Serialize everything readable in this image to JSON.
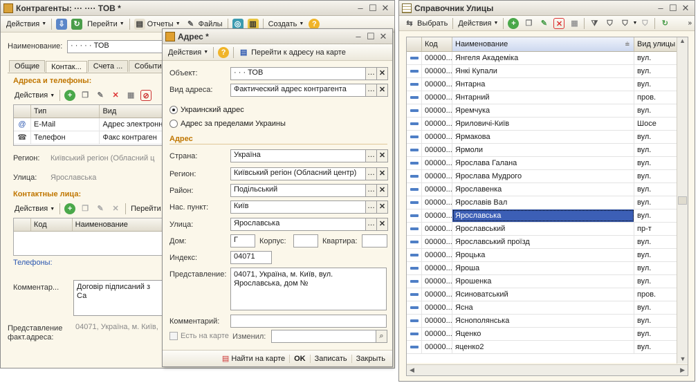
{
  "win1": {
    "title": "Контрагенты: ··· ···· ТОВ *",
    "toolbar": {
      "actions": "Действия",
      "goto": "Перейти",
      "reports": "Отчеты",
      "files": "Файлы",
      "create": "Создать"
    },
    "name_label": "Наименование:",
    "name_value": "· · ·  ·  ·  ТОВ",
    "tabs": [
      "Общие",
      "Контак...",
      "Счета ...",
      "События"
    ],
    "section_addresses": "Адреса и телефоны:",
    "grid_actions": "Действия",
    "contacts_header": [
      "Тип",
      "Вид"
    ],
    "contacts_rows": [
      {
        "icon": "@",
        "type": "E-Mail",
        "kind": "Адрес электронн"
      },
      {
        "icon": "☎",
        "type": "Телефон",
        "kind": "Факс контраген"
      }
    ],
    "region_label": "Регион:",
    "region_value": "Київський регіон  (Обласний ц",
    "street_label": "Улица:",
    "street_value": "Ярославська",
    "section_persons": "Контактные лица:",
    "persons_actions": "Действия",
    "persons_goto": "Перейти",
    "persons_header": [
      "Код",
      "Наименование"
    ],
    "phones_link": "Телефоны:",
    "comment_label": "Комментар...",
    "comment_value": "Договір підписаний з Са",
    "fact_label": "Представление\nфакт.адреса:",
    "fact_value": "04071, Україна, м. Київ,"
  },
  "win2": {
    "title": "Адрес *",
    "toolbar": {
      "actions": "Действия",
      "goto_map": "Перейти к адресу на карте"
    },
    "object_label": "Объект:",
    "object_value": "·  ·  ·  ТОВ",
    "addrtype_label": "Вид адреса:",
    "addrtype_value": "Фактический адрес контрагента",
    "radio_ukr": "Украинский адрес",
    "radio_foreign": "Адрес за пределами Украины",
    "section_address": "Адрес",
    "country_label": "Страна:",
    "country_value": "Україна",
    "region_label": "Регион:",
    "region_value": "Київський регіон  (Обласний центр)",
    "district_label": "Район:",
    "district_value": "Подільський",
    "city_label": "Нас. пункт:",
    "city_value": "Київ",
    "street_label": "Улица:",
    "street_value": "Ярославська",
    "house_label": "Дом:",
    "house_value": "Г",
    "korpus_label": "Корпус:",
    "korpus_value": "",
    "flat_label": "Квартира:",
    "flat_value": "",
    "index_label": "Индекс:",
    "index_value": "04071",
    "repr_label": "Представление:",
    "repr_value": "04071, Україна, м. Київ, вул.\nЯрославська, дом №",
    "comment_label": "Комментарий:",
    "comment_value": "",
    "onmap_label": "Есть на карте",
    "changed_label": "Изменил:",
    "changed_value": "",
    "buttons": {
      "map": "Найти на карте",
      "ok": "OK",
      "save": "Записать",
      "close": "Закрыть"
    }
  },
  "win3": {
    "title": "Справочник Улицы",
    "toolbar": {
      "select": "Выбрать",
      "actions": "Действия"
    },
    "header": {
      "code": "Код",
      "name": "Наименование",
      "kind": "Вид улицы"
    },
    "rows": [
      {
        "code": "00000...",
        "name": "Янгеля Академіка",
        "kind": "вул."
      },
      {
        "code": "00000...",
        "name": "Янкі Купали",
        "kind": "вул."
      },
      {
        "code": "00000...",
        "name": "Янтарна",
        "kind": "вул."
      },
      {
        "code": "00000...",
        "name": "Янтарний",
        "kind": "пров."
      },
      {
        "code": "00000...",
        "name": "Яремчука",
        "kind": "вул."
      },
      {
        "code": "00000...",
        "name": "Яриловичі-Київ",
        "kind": "Шосе"
      },
      {
        "code": "00000...",
        "name": "Ярмакова",
        "kind": "вул."
      },
      {
        "code": "00000...",
        "name": "Ярмоли",
        "kind": "вул."
      },
      {
        "code": "00000...",
        "name": "Ярослава Галана",
        "kind": "вул."
      },
      {
        "code": "00000...",
        "name": "Ярослава Мудрого",
        "kind": "вул."
      },
      {
        "code": "00000...",
        "name": "Ярославенка",
        "kind": "вул."
      },
      {
        "code": "00000...",
        "name": "Ярославів Вал",
        "kind": "вул."
      },
      {
        "code": "00000...",
        "name": "Ярославська",
        "kind": "вул."
      },
      {
        "code": "00000...",
        "name": "Ярославський",
        "kind": "пр-т"
      },
      {
        "code": "00000...",
        "name": "Ярославський проїзд",
        "kind": "вул."
      },
      {
        "code": "00000...",
        "name": "Яроцька",
        "kind": "вул."
      },
      {
        "code": "00000...",
        "name": "Яроша",
        "kind": "вул."
      },
      {
        "code": "00000...",
        "name": "Ярошенка",
        "kind": "вул."
      },
      {
        "code": "00000...",
        "name": "Ясиноватський",
        "kind": "пров."
      },
      {
        "code": "00000...",
        "name": "Ясна",
        "kind": "вул."
      },
      {
        "code": "00000...",
        "name": "Яснополянська",
        "kind": "вул."
      },
      {
        "code": "00000...",
        "name": "Яценко",
        "kind": "вул."
      },
      {
        "code": "00000...",
        "name": "яценко2",
        "kind": "вул."
      }
    ],
    "selected_index": 12
  }
}
